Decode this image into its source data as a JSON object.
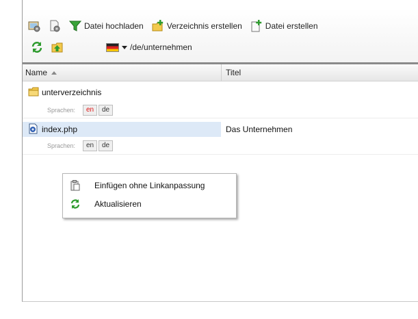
{
  "toolbar": {
    "upload_label": "Datei hochladen",
    "create_dir_label": "Verzeichnis erstellen",
    "create_file_label": "Datei erstellen"
  },
  "path": {
    "text": "/de/unternehmen",
    "language_flag": "de"
  },
  "columns": {
    "name": "Name",
    "title": "Titel"
  },
  "rows": [
    {
      "name": "unterverzeichnis",
      "title": "",
      "icon": "folder-icon",
      "languages_label": "Sprachen:",
      "languages": [
        "en",
        "de"
      ]
    },
    {
      "name": "index.php",
      "title": "Das Unternehmen",
      "icon": "php-file-icon",
      "languages_label": "Sprachen:",
      "languages": [
        "en",
        "de"
      ]
    }
  ],
  "context_menu": {
    "items": [
      {
        "label": "Einfügen ohne Linkanpassung",
        "icon": "paste-icon"
      },
      {
        "label": "Aktualisieren",
        "icon": "refresh-icon"
      }
    ]
  },
  "colors": {
    "accent_green": "#2e9b2e",
    "folder_yellow": "#f2c94c",
    "lang_active": "#d11111",
    "selection": "#dde9f7"
  }
}
